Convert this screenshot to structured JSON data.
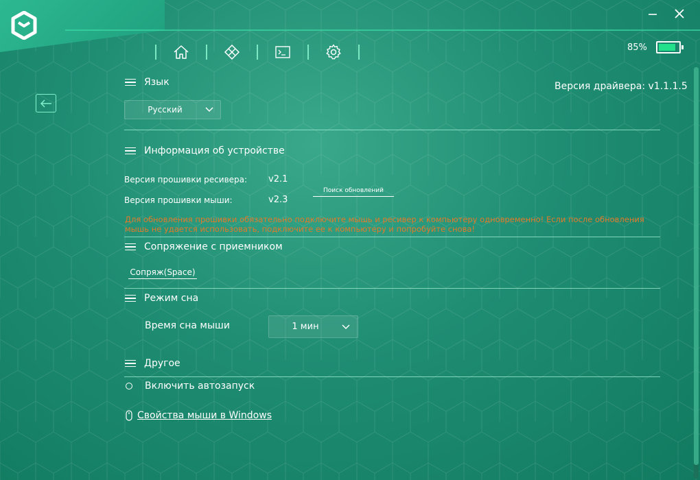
{
  "window": {
    "minimize_icon": "minimize-icon",
    "close_icon": "close-icon"
  },
  "nav": {
    "items": [
      "home-icon",
      "diamond-grid-icon",
      "terminal-icon",
      "gear-icon"
    ]
  },
  "battery": {
    "percent_label": "85%",
    "level": 0.85,
    "fill_color": "#23e08a"
  },
  "driver_version": "Версия драйвера: v1.1.1.5",
  "language": {
    "title": "Язык",
    "selected": "Русский"
  },
  "device_info": {
    "title": "Информация об устройстве",
    "receiver_fw_label": "Версия прошивки ресивера:",
    "receiver_fw_value": "v2.1",
    "mouse_fw_label": "Версия прошивки мыши:",
    "mouse_fw_value": "v2.3",
    "check_updates": "Поиск обновлений",
    "warning": "Для обновления прошивки обязательно подключите мышь и ресивер к компьютеру одновременно! Если после обновления мышь не удается использовать, подключите ее к компьютеру и попробуйте снова!",
    "warning_color": "#e37a2a"
  },
  "pairing": {
    "title": "Сопряжение с приемником",
    "button": "Сопряж(Space)"
  },
  "sleep": {
    "title": "Режим сна",
    "label": "Время сна мыши",
    "selected": "1 мин"
  },
  "other": {
    "title": "Другое",
    "autostart_label": "Включить автозапуск",
    "mouse_properties_link": "Свойства мыши в Windows"
  }
}
